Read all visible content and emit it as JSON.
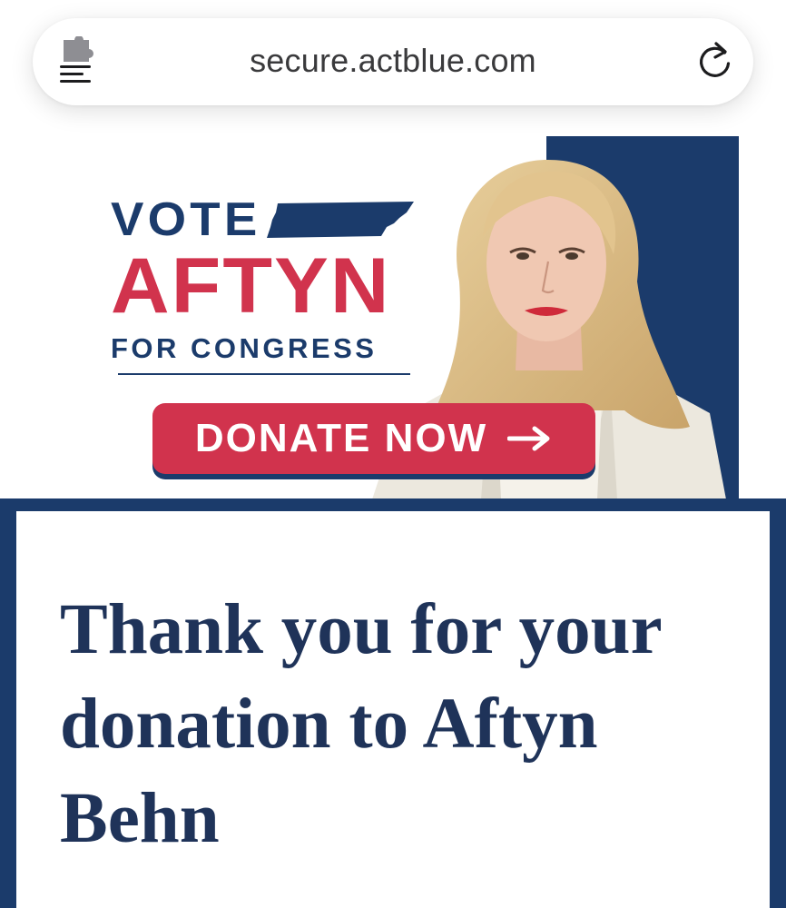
{
  "browser": {
    "url": "secure.actblue.com",
    "menu_icon": "extension-menu-icon",
    "reload_icon": "reload-icon"
  },
  "banner": {
    "vote": "VOTE",
    "name": "AFTYN",
    "tagline": "FOR CONGRESS",
    "donate_label": "DONATE NOW",
    "arrow_icon": "arrow-right-icon",
    "state_icon": "tennessee-map-icon",
    "colors": {
      "navy": "#1b3b6b",
      "red": "#d1334d"
    }
  },
  "confirmation": {
    "heading": "Thank you for your donation to Aftyn Behn"
  }
}
